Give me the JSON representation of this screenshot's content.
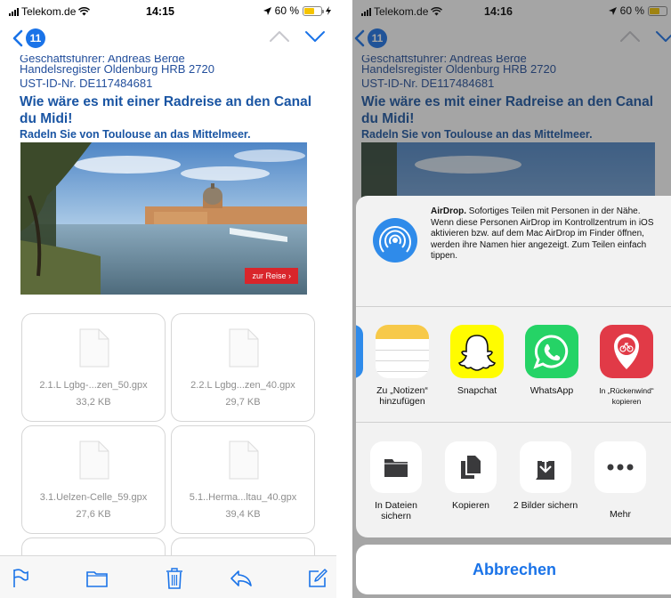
{
  "left_phone": {
    "status": {
      "carrier": "Telekom.de",
      "time": "14:15",
      "battery": "60 %"
    },
    "nav": {
      "back_count": "11"
    },
    "email": {
      "clipped_line": "Geschäftsführer: Andreas Berge",
      "register": "Handelsregister Oldenburg HRB 2720",
      "ust_id": "UST-ID-Nr. DE117484681",
      "headline": "Wie wäre es mit einer Radreise an den Canal du Midi!",
      "subline": "Radeln Sie von Toulouse an das Mittelmeer.",
      "hero_cta": "zur Reise ›"
    },
    "attachments": [
      {
        "name": "2.1.L Lgbg-...zen_50.gpx",
        "size": "33,2 KB"
      },
      {
        "name": "2.2.L Lgbg...zen_40.gpx",
        "size": "29,7 KB"
      },
      {
        "name": "3.1.Uelzen-Celle_59.gpx",
        "size": "27,6 KB"
      },
      {
        "name": "5.1..Herma...ltau_40.gpx",
        "size": "39,4 KB"
      }
    ],
    "toolbar": {
      "icons": [
        "flag-icon",
        "folder-icon",
        "trash-icon",
        "reply-icon",
        "compose-icon"
      ]
    }
  },
  "right_phone": {
    "status": {
      "carrier": "Telekom.de",
      "time": "14:16",
      "battery": "60 %"
    },
    "nav": {
      "back_count": "11"
    },
    "email": {
      "clipped_line": "Geschäftsführer: Andreas Berge",
      "register": "Handelsregister Oldenburg HRB 2720",
      "ust_id": "UST-ID-Nr. DE117484681",
      "headline": "Wie wäre es mit einer Radreise an den Canal du Midi!",
      "subline": "Radeln Sie von Toulouse an das Mittelmeer."
    },
    "share_sheet": {
      "airdrop_title": "AirDrop.",
      "airdrop_text": "Sofortiges Teilen mit Personen in der Nähe. Wenn diese Personen AirDrop im Kontrollzentrum in iOS aktivieren bzw. auf dem Mac AirDrop im Finder öffnen, werden ihre Namen hier angezeigt. Zum Teilen einfach tippen.",
      "apps": [
        {
          "label": "Zu „Notizen“ hinzufügen",
          "icon": "notes-icon"
        },
        {
          "label": "Snapchat",
          "icon": "snapchat-icon"
        },
        {
          "label": "WhatsApp",
          "icon": "whatsapp-icon"
        },
        {
          "label": "In „Rückenwind“ kopieren",
          "icon": "rueckenwind-icon"
        }
      ],
      "actions": [
        {
          "label": "In Dateien sichern",
          "icon": "folder-icon"
        },
        {
          "label": "Kopieren",
          "icon": "copy-icon"
        },
        {
          "label": "2 Bilder sichern",
          "icon": "save-image-icon"
        },
        {
          "label": "Mehr",
          "icon": "more-icon"
        }
      ],
      "cancel": "Abbrechen"
    }
  },
  "colors": {
    "accent": "#1a73e8",
    "email_link": "#234f9c",
    "battery": "#f5c400",
    "cta": "#d9252b"
  }
}
